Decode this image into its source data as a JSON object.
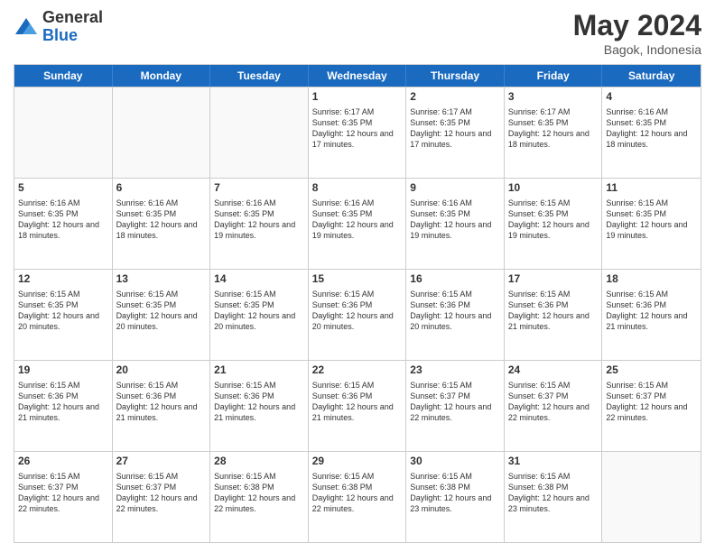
{
  "header": {
    "logo_general": "General",
    "logo_blue": "Blue",
    "month_year": "May 2024",
    "location": "Bagok, Indonesia"
  },
  "days_of_week": [
    "Sunday",
    "Monday",
    "Tuesday",
    "Wednesday",
    "Thursday",
    "Friday",
    "Saturday"
  ],
  "weeks": [
    [
      {
        "day": "",
        "info": ""
      },
      {
        "day": "",
        "info": ""
      },
      {
        "day": "",
        "info": ""
      },
      {
        "day": "1",
        "info": "Sunrise: 6:17 AM\nSunset: 6:35 PM\nDaylight: 12 hours and 17 minutes."
      },
      {
        "day": "2",
        "info": "Sunrise: 6:17 AM\nSunset: 6:35 PM\nDaylight: 12 hours and 17 minutes."
      },
      {
        "day": "3",
        "info": "Sunrise: 6:17 AM\nSunset: 6:35 PM\nDaylight: 12 hours and 18 minutes."
      },
      {
        "day": "4",
        "info": "Sunrise: 6:16 AM\nSunset: 6:35 PM\nDaylight: 12 hours and 18 minutes."
      }
    ],
    [
      {
        "day": "5",
        "info": "Sunrise: 6:16 AM\nSunset: 6:35 PM\nDaylight: 12 hours and 18 minutes."
      },
      {
        "day": "6",
        "info": "Sunrise: 6:16 AM\nSunset: 6:35 PM\nDaylight: 12 hours and 18 minutes."
      },
      {
        "day": "7",
        "info": "Sunrise: 6:16 AM\nSunset: 6:35 PM\nDaylight: 12 hours and 19 minutes."
      },
      {
        "day": "8",
        "info": "Sunrise: 6:16 AM\nSunset: 6:35 PM\nDaylight: 12 hours and 19 minutes."
      },
      {
        "day": "9",
        "info": "Sunrise: 6:16 AM\nSunset: 6:35 PM\nDaylight: 12 hours and 19 minutes."
      },
      {
        "day": "10",
        "info": "Sunrise: 6:15 AM\nSunset: 6:35 PM\nDaylight: 12 hours and 19 minutes."
      },
      {
        "day": "11",
        "info": "Sunrise: 6:15 AM\nSunset: 6:35 PM\nDaylight: 12 hours and 19 minutes."
      }
    ],
    [
      {
        "day": "12",
        "info": "Sunrise: 6:15 AM\nSunset: 6:35 PM\nDaylight: 12 hours and 20 minutes."
      },
      {
        "day": "13",
        "info": "Sunrise: 6:15 AM\nSunset: 6:35 PM\nDaylight: 12 hours and 20 minutes."
      },
      {
        "day": "14",
        "info": "Sunrise: 6:15 AM\nSunset: 6:35 PM\nDaylight: 12 hours and 20 minutes."
      },
      {
        "day": "15",
        "info": "Sunrise: 6:15 AM\nSunset: 6:36 PM\nDaylight: 12 hours and 20 minutes."
      },
      {
        "day": "16",
        "info": "Sunrise: 6:15 AM\nSunset: 6:36 PM\nDaylight: 12 hours and 20 minutes."
      },
      {
        "day": "17",
        "info": "Sunrise: 6:15 AM\nSunset: 6:36 PM\nDaylight: 12 hours and 21 minutes."
      },
      {
        "day": "18",
        "info": "Sunrise: 6:15 AM\nSunset: 6:36 PM\nDaylight: 12 hours and 21 minutes."
      }
    ],
    [
      {
        "day": "19",
        "info": "Sunrise: 6:15 AM\nSunset: 6:36 PM\nDaylight: 12 hours and 21 minutes."
      },
      {
        "day": "20",
        "info": "Sunrise: 6:15 AM\nSunset: 6:36 PM\nDaylight: 12 hours and 21 minutes."
      },
      {
        "day": "21",
        "info": "Sunrise: 6:15 AM\nSunset: 6:36 PM\nDaylight: 12 hours and 21 minutes."
      },
      {
        "day": "22",
        "info": "Sunrise: 6:15 AM\nSunset: 6:36 PM\nDaylight: 12 hours and 21 minutes."
      },
      {
        "day": "23",
        "info": "Sunrise: 6:15 AM\nSunset: 6:37 PM\nDaylight: 12 hours and 22 minutes."
      },
      {
        "day": "24",
        "info": "Sunrise: 6:15 AM\nSunset: 6:37 PM\nDaylight: 12 hours and 22 minutes."
      },
      {
        "day": "25",
        "info": "Sunrise: 6:15 AM\nSunset: 6:37 PM\nDaylight: 12 hours and 22 minutes."
      }
    ],
    [
      {
        "day": "26",
        "info": "Sunrise: 6:15 AM\nSunset: 6:37 PM\nDaylight: 12 hours and 22 minutes."
      },
      {
        "day": "27",
        "info": "Sunrise: 6:15 AM\nSunset: 6:37 PM\nDaylight: 12 hours and 22 minutes."
      },
      {
        "day": "28",
        "info": "Sunrise: 6:15 AM\nSunset: 6:38 PM\nDaylight: 12 hours and 22 minutes."
      },
      {
        "day": "29",
        "info": "Sunrise: 6:15 AM\nSunset: 6:38 PM\nDaylight: 12 hours and 22 minutes."
      },
      {
        "day": "30",
        "info": "Sunrise: 6:15 AM\nSunset: 6:38 PM\nDaylight: 12 hours and 23 minutes."
      },
      {
        "day": "31",
        "info": "Sunrise: 6:15 AM\nSunset: 6:38 PM\nDaylight: 12 hours and 23 minutes."
      },
      {
        "day": "",
        "info": ""
      }
    ]
  ]
}
